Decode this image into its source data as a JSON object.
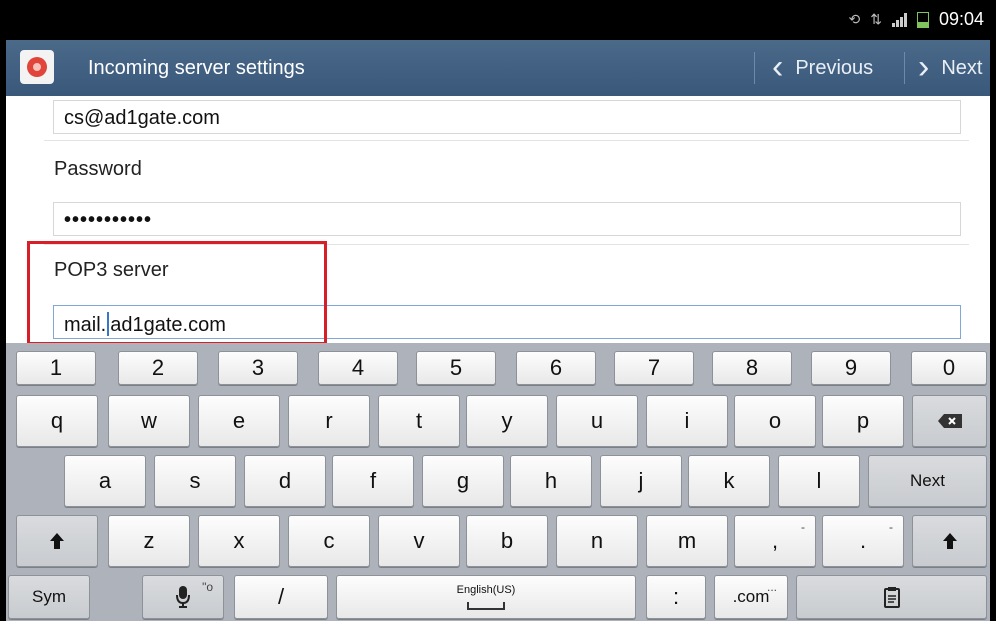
{
  "status": {
    "time": "09:04"
  },
  "header": {
    "title": "Incoming server settings",
    "previous": "Previous",
    "next": "Next"
  },
  "form": {
    "username_value": "cs@ad1gate.com",
    "password_label": "Password",
    "password_value": "•••••••••••",
    "pop3_label": "POP3 server",
    "pop3_value_before_cursor": "mail.",
    "pop3_value_after_cursor": "ad1gate.com"
  },
  "keyboard": {
    "numbers": [
      "1",
      "2",
      "3",
      "4",
      "5",
      "6",
      "7",
      "8",
      "9",
      "0"
    ],
    "row1": [
      "q",
      "w",
      "e",
      "r",
      "t",
      "y",
      "u",
      "i",
      "o",
      "p"
    ],
    "row2": [
      "a",
      "s",
      "d",
      "f",
      "g",
      "h",
      "j",
      "k",
      "l"
    ],
    "row3": [
      "z",
      "x",
      "c",
      "v",
      "b",
      "n",
      "m"
    ],
    "backspace_icon": "backspace-icon",
    "next": "Next",
    "shift_icon": "shift-icon",
    "comma": ",",
    "comma_hint": "-",
    "period": ".",
    "period_hint": "-",
    "sym": "Sym",
    "mic_icon": "microphone-icon",
    "mic_hint": "\"o",
    "slash": "/",
    "space_label": "English(US)",
    "colon": ":",
    "dotcom": ".com",
    "dotcom_hint": "...",
    "clipboard_icon": "clipboard-icon"
  }
}
